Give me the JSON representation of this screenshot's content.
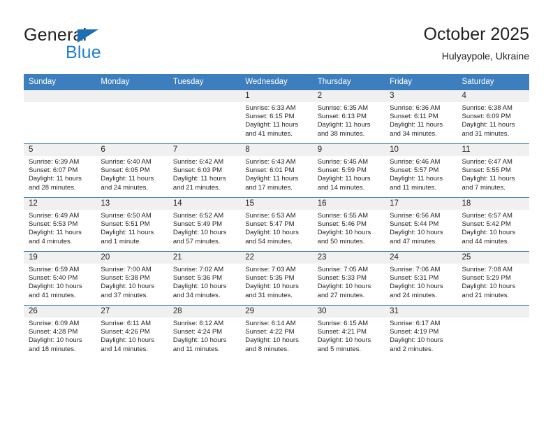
{
  "brand": {
    "word_one": "General",
    "word_two": "Blue"
  },
  "header": {
    "title": "October 2025",
    "location": "Hulyaypole, Ukraine"
  },
  "calendar": {
    "weekday_headers": [
      "Sunday",
      "Monday",
      "Tuesday",
      "Wednesday",
      "Thursday",
      "Friday",
      "Saturday"
    ],
    "accent_color": "#3d7ebe",
    "daynum_band_color": "#f0f0f0",
    "weeks": [
      [
        {
          "day": "",
          "blank": true,
          "sunrise": "",
          "sunset": "",
          "daylight1": "",
          "daylight2": ""
        },
        {
          "day": "",
          "blank": true,
          "sunrise": "",
          "sunset": "",
          "daylight1": "",
          "daylight2": ""
        },
        {
          "day": "",
          "blank": true,
          "sunrise": "",
          "sunset": "",
          "daylight1": "",
          "daylight2": ""
        },
        {
          "day": "1",
          "blank": false,
          "sunrise": "Sunrise: 6:33 AM",
          "sunset": "Sunset: 6:15 PM",
          "daylight1": "Daylight: 11 hours",
          "daylight2": "and 41 minutes."
        },
        {
          "day": "2",
          "blank": false,
          "sunrise": "Sunrise: 6:35 AM",
          "sunset": "Sunset: 6:13 PM",
          "daylight1": "Daylight: 11 hours",
          "daylight2": "and 38 minutes."
        },
        {
          "day": "3",
          "blank": false,
          "sunrise": "Sunrise: 6:36 AM",
          "sunset": "Sunset: 6:11 PM",
          "daylight1": "Daylight: 11 hours",
          "daylight2": "and 34 minutes."
        },
        {
          "day": "4",
          "blank": false,
          "sunrise": "Sunrise: 6:38 AM",
          "sunset": "Sunset: 6:09 PM",
          "daylight1": "Daylight: 11 hours",
          "daylight2": "and 31 minutes."
        }
      ],
      [
        {
          "day": "5",
          "blank": false,
          "sunrise": "Sunrise: 6:39 AM",
          "sunset": "Sunset: 6:07 PM",
          "daylight1": "Daylight: 11 hours",
          "daylight2": "and 28 minutes."
        },
        {
          "day": "6",
          "blank": false,
          "sunrise": "Sunrise: 6:40 AM",
          "sunset": "Sunset: 6:05 PM",
          "daylight1": "Daylight: 11 hours",
          "daylight2": "and 24 minutes."
        },
        {
          "day": "7",
          "blank": false,
          "sunrise": "Sunrise: 6:42 AM",
          "sunset": "Sunset: 6:03 PM",
          "daylight1": "Daylight: 11 hours",
          "daylight2": "and 21 minutes."
        },
        {
          "day": "8",
          "blank": false,
          "sunrise": "Sunrise: 6:43 AM",
          "sunset": "Sunset: 6:01 PM",
          "daylight1": "Daylight: 11 hours",
          "daylight2": "and 17 minutes."
        },
        {
          "day": "9",
          "blank": false,
          "sunrise": "Sunrise: 6:45 AM",
          "sunset": "Sunset: 5:59 PM",
          "daylight1": "Daylight: 11 hours",
          "daylight2": "and 14 minutes."
        },
        {
          "day": "10",
          "blank": false,
          "sunrise": "Sunrise: 6:46 AM",
          "sunset": "Sunset: 5:57 PM",
          "daylight1": "Daylight: 11 hours",
          "daylight2": "and 11 minutes."
        },
        {
          "day": "11",
          "blank": false,
          "sunrise": "Sunrise: 6:47 AM",
          "sunset": "Sunset: 5:55 PM",
          "daylight1": "Daylight: 11 hours",
          "daylight2": "and 7 minutes."
        }
      ],
      [
        {
          "day": "12",
          "blank": false,
          "sunrise": "Sunrise: 6:49 AM",
          "sunset": "Sunset: 5:53 PM",
          "daylight1": "Daylight: 11 hours",
          "daylight2": "and 4 minutes."
        },
        {
          "day": "13",
          "blank": false,
          "sunrise": "Sunrise: 6:50 AM",
          "sunset": "Sunset: 5:51 PM",
          "daylight1": "Daylight: 11 hours",
          "daylight2": "and 1 minute."
        },
        {
          "day": "14",
          "blank": false,
          "sunrise": "Sunrise: 6:52 AM",
          "sunset": "Sunset: 5:49 PM",
          "daylight1": "Daylight: 10 hours",
          "daylight2": "and 57 minutes."
        },
        {
          "day": "15",
          "blank": false,
          "sunrise": "Sunrise: 6:53 AM",
          "sunset": "Sunset: 5:47 PM",
          "daylight1": "Daylight: 10 hours",
          "daylight2": "and 54 minutes."
        },
        {
          "day": "16",
          "blank": false,
          "sunrise": "Sunrise: 6:55 AM",
          "sunset": "Sunset: 5:46 PM",
          "daylight1": "Daylight: 10 hours",
          "daylight2": "and 50 minutes."
        },
        {
          "day": "17",
          "blank": false,
          "sunrise": "Sunrise: 6:56 AM",
          "sunset": "Sunset: 5:44 PM",
          "daylight1": "Daylight: 10 hours",
          "daylight2": "and 47 minutes."
        },
        {
          "day": "18",
          "blank": false,
          "sunrise": "Sunrise: 6:57 AM",
          "sunset": "Sunset: 5:42 PM",
          "daylight1": "Daylight: 10 hours",
          "daylight2": "and 44 minutes."
        }
      ],
      [
        {
          "day": "19",
          "blank": false,
          "sunrise": "Sunrise: 6:59 AM",
          "sunset": "Sunset: 5:40 PM",
          "daylight1": "Daylight: 10 hours",
          "daylight2": "and 41 minutes."
        },
        {
          "day": "20",
          "blank": false,
          "sunrise": "Sunrise: 7:00 AM",
          "sunset": "Sunset: 5:38 PM",
          "daylight1": "Daylight: 10 hours",
          "daylight2": "and 37 minutes."
        },
        {
          "day": "21",
          "blank": false,
          "sunrise": "Sunrise: 7:02 AM",
          "sunset": "Sunset: 5:36 PM",
          "daylight1": "Daylight: 10 hours",
          "daylight2": "and 34 minutes."
        },
        {
          "day": "22",
          "blank": false,
          "sunrise": "Sunrise: 7:03 AM",
          "sunset": "Sunset: 5:35 PM",
          "daylight1": "Daylight: 10 hours",
          "daylight2": "and 31 minutes."
        },
        {
          "day": "23",
          "blank": false,
          "sunrise": "Sunrise: 7:05 AM",
          "sunset": "Sunset: 5:33 PM",
          "daylight1": "Daylight: 10 hours",
          "daylight2": "and 27 minutes."
        },
        {
          "day": "24",
          "blank": false,
          "sunrise": "Sunrise: 7:06 AM",
          "sunset": "Sunset: 5:31 PM",
          "daylight1": "Daylight: 10 hours",
          "daylight2": "and 24 minutes."
        },
        {
          "day": "25",
          "blank": false,
          "sunrise": "Sunrise: 7:08 AM",
          "sunset": "Sunset: 5:29 PM",
          "daylight1": "Daylight: 10 hours",
          "daylight2": "and 21 minutes."
        }
      ],
      [
        {
          "day": "26",
          "blank": false,
          "sunrise": "Sunrise: 6:09 AM",
          "sunset": "Sunset: 4:28 PM",
          "daylight1": "Daylight: 10 hours",
          "daylight2": "and 18 minutes."
        },
        {
          "day": "27",
          "blank": false,
          "sunrise": "Sunrise: 6:11 AM",
          "sunset": "Sunset: 4:26 PM",
          "daylight1": "Daylight: 10 hours",
          "daylight2": "and 14 minutes."
        },
        {
          "day": "28",
          "blank": false,
          "sunrise": "Sunrise: 6:12 AM",
          "sunset": "Sunset: 4:24 PM",
          "daylight1": "Daylight: 10 hours",
          "daylight2": "and 11 minutes."
        },
        {
          "day": "29",
          "blank": false,
          "sunrise": "Sunrise: 6:14 AM",
          "sunset": "Sunset: 4:22 PM",
          "daylight1": "Daylight: 10 hours",
          "daylight2": "and 8 minutes."
        },
        {
          "day": "30",
          "blank": false,
          "sunrise": "Sunrise: 6:15 AM",
          "sunset": "Sunset: 4:21 PM",
          "daylight1": "Daylight: 10 hours",
          "daylight2": "and 5 minutes."
        },
        {
          "day": "31",
          "blank": false,
          "sunrise": "Sunrise: 6:17 AM",
          "sunset": "Sunset: 4:19 PM",
          "daylight1": "Daylight: 10 hours",
          "daylight2": "and 2 minutes."
        },
        {
          "day": "",
          "blank": true,
          "sunrise": "",
          "sunset": "",
          "daylight1": "",
          "daylight2": ""
        }
      ]
    ]
  }
}
